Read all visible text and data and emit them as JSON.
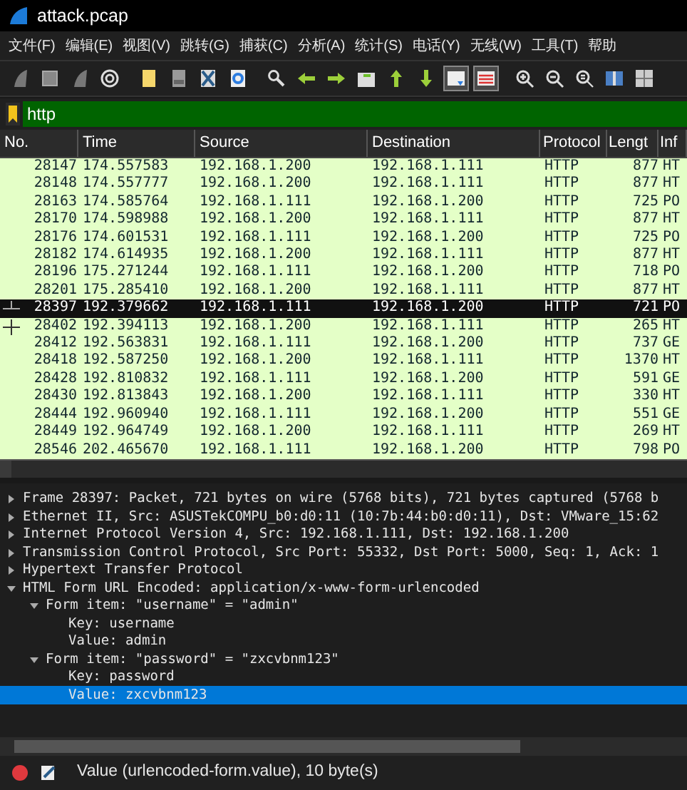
{
  "window": {
    "title": "attack.pcap"
  },
  "menu": [
    "文件(F)",
    "编辑(E)",
    "视图(V)",
    "跳转(G)",
    "捕获(C)",
    "分析(A)",
    "统计(S)",
    "电话(Y)",
    "无线(W)",
    "工具(T)",
    "帮助"
  ],
  "toolbar": [
    [
      {
        "kind": "fin",
        "pressed": false
      },
      {
        "kind": "stop",
        "pressed": false
      },
      {
        "kind": "fin",
        "pressed": false
      },
      {
        "kind": "gear",
        "pressed": false
      }
    ],
    [
      {
        "kind": "folder",
        "pressed": false
      },
      {
        "kind": "file",
        "pressed": false
      },
      {
        "kind": "close",
        "pressed": false
      },
      {
        "kind": "reload",
        "pressed": false
      }
    ],
    [
      {
        "kind": "search",
        "pressed": false
      },
      {
        "kind": "left",
        "pressed": false
      },
      {
        "kind": "right",
        "pressed": false
      },
      {
        "kind": "jump",
        "pressed": false
      },
      {
        "kind": "up",
        "pressed": false
      },
      {
        "kind": "down",
        "pressed": false
      },
      {
        "kind": "scroll",
        "pressed": true
      },
      {
        "kind": "color",
        "pressed": true
      }
    ],
    [
      {
        "kind": "zoomin",
        "pressed": false
      },
      {
        "kind": "zoomout",
        "pressed": false
      },
      {
        "kind": "zoom",
        "pressed": false
      },
      {
        "kind": "cols",
        "pressed": false
      },
      {
        "kind": "rows",
        "pressed": false
      }
    ]
  ],
  "filter": {
    "value": "http"
  },
  "table": {
    "columns": [
      "No.",
      "Time",
      "Source",
      "Destination",
      "Protocol",
      "Lengt",
      "Inf"
    ],
    "rows": [
      {
        "cells": [
          "28147",
          "174.557583",
          "192.168.1.200",
          "192.168.1.111",
          "HTTP",
          "877",
          "HT"
        ],
        "selected": false,
        "related": false
      },
      {
        "cells": [
          "28148",
          "174.557777",
          "192.168.1.200",
          "192.168.1.111",
          "HTTP",
          "877",
          "HT"
        ],
        "selected": false,
        "related": false
      },
      {
        "cells": [
          "28163",
          "174.585764",
          "192.168.1.111",
          "192.168.1.200",
          "HTTP",
          "725",
          "PO"
        ],
        "selected": false,
        "related": false
      },
      {
        "cells": [
          "28170",
          "174.598988",
          "192.168.1.200",
          "192.168.1.111",
          "HTTP",
          "877",
          "HT"
        ],
        "selected": false,
        "related": false
      },
      {
        "cells": [
          "28176",
          "174.601531",
          "192.168.1.111",
          "192.168.1.200",
          "HTTP",
          "725",
          "PO"
        ],
        "selected": false,
        "related": false
      },
      {
        "cells": [
          "28182",
          "174.614935",
          "192.168.1.200",
          "192.168.1.111",
          "HTTP",
          "877",
          "HT"
        ],
        "selected": false,
        "related": false
      },
      {
        "cells": [
          "28196",
          "175.271244",
          "192.168.1.111",
          "192.168.1.200",
          "HTTP",
          "718",
          "PO"
        ],
        "selected": false,
        "related": false
      },
      {
        "cells": [
          "28201",
          "175.285410",
          "192.168.1.200",
          "192.168.1.111",
          "HTTP",
          "877",
          "HT"
        ],
        "selected": false,
        "related": false
      },
      {
        "cells": [
          "28397",
          "192.379662",
          "192.168.1.111",
          "192.168.1.200",
          "HTTP",
          "721",
          "PO"
        ],
        "selected": true,
        "related": true
      },
      {
        "cells": [
          "28402",
          "192.394113",
          "192.168.1.200",
          "192.168.1.111",
          "HTTP",
          "265",
          "HT"
        ],
        "selected": false,
        "related": true
      },
      {
        "cells": [
          "28412",
          "192.563831",
          "192.168.1.111",
          "192.168.1.200",
          "HTTP",
          "737",
          "GE"
        ],
        "selected": false,
        "related": false
      },
      {
        "cells": [
          "28418",
          "192.587250",
          "192.168.1.200",
          "192.168.1.111",
          "HTTP",
          "1370",
          "HT"
        ],
        "selected": false,
        "related": false
      },
      {
        "cells": [
          "28428",
          "192.810832",
          "192.168.1.111",
          "192.168.1.200",
          "HTTP",
          "591",
          "GE"
        ],
        "selected": false,
        "related": false
      },
      {
        "cells": [
          "28430",
          "192.813843",
          "192.168.1.200",
          "192.168.1.111",
          "HTTP",
          "330",
          "HT"
        ],
        "selected": false,
        "related": false
      },
      {
        "cells": [
          "28444",
          "192.960940",
          "192.168.1.111",
          "192.168.1.200",
          "HTTP",
          "551",
          "GE"
        ],
        "selected": false,
        "related": false
      },
      {
        "cells": [
          "28449",
          "192.964749",
          "192.168.1.200",
          "192.168.1.111",
          "HTTP",
          "269",
          "HT"
        ],
        "selected": false,
        "related": false
      },
      {
        "cells": [
          "28546",
          "202.465670",
          "192.168.1.111",
          "192.168.1.200",
          "HTTP",
          "798",
          "PO"
        ],
        "selected": false,
        "related": false
      }
    ]
  },
  "details": [
    {
      "label": "Frame 28397: Packet, 721 bytes on wire (5768 bits), 721 bytes captured (5768 b",
      "expanded": false,
      "selected": false
    },
    {
      "label": "Ethernet II, Src: ASUSTekCOMPU_b0:d0:11 (10:7b:44:b0:d0:11), Dst: VMware_15:62",
      "expanded": false,
      "selected": false
    },
    {
      "label": "Internet Protocol Version 4, Src: 192.168.1.111, Dst: 192.168.1.200",
      "expanded": false,
      "selected": false
    },
    {
      "label": "Transmission Control Protocol, Src Port: 55332, Dst Port: 5000, Seq: 1, Ack: 1",
      "expanded": false,
      "selected": false
    },
    {
      "label": "Hypertext Transfer Protocol",
      "expanded": false,
      "selected": false
    },
    {
      "label": "HTML Form URL Encoded: application/x-www-form-urlencoded",
      "expanded": true,
      "selected": false,
      "children": [
        {
          "label": "Form item: \"username\" = \"admin\"",
          "expanded": true,
          "selected": false,
          "children": [
            {
              "label": "Key: username",
              "selected": false
            },
            {
              "label": "Value: admin",
              "selected": false
            }
          ]
        },
        {
          "label": "Form item: \"password\" = \"zxcvbnm123\"",
          "expanded": true,
          "selected": false,
          "children": [
            {
              "label": "Key: password",
              "selected": false
            },
            {
              "label": "Value: zxcvbnm123",
              "selected": true
            }
          ]
        }
      ]
    }
  ],
  "status_bar": {
    "text": "Value (urlencoded-form.value), 10 byte(s)"
  }
}
